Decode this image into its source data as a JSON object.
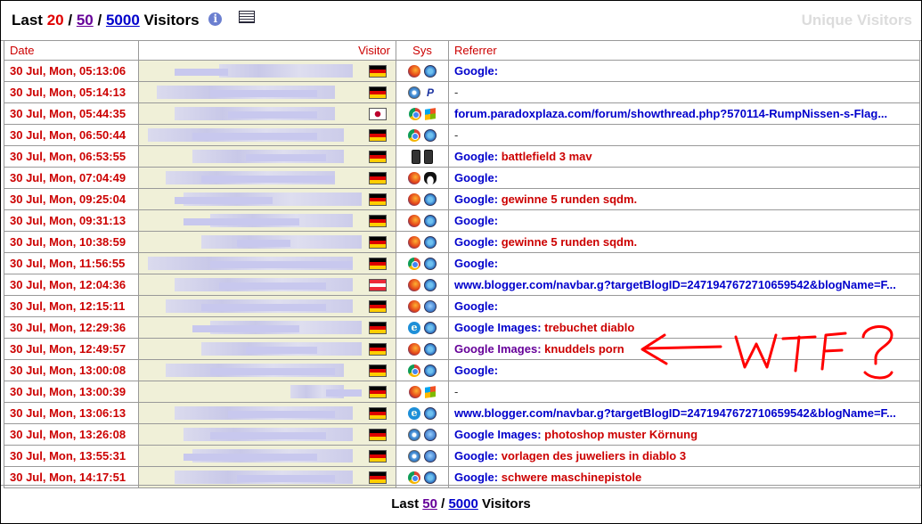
{
  "header": {
    "prefix": "Last",
    "n20": "20",
    "n50": "50",
    "n5000": "5000",
    "suffix": "Visitors",
    "sep": "/",
    "unique": "Unique Visitors"
  },
  "columns": [
    "Date",
    "Visitor",
    "Sys",
    "Referrer"
  ],
  "rows": [
    {
      "date": "30 Jul, Mon, 05:13:06",
      "flag": "de",
      "browser": "firefox",
      "os": "windows",
      "src": "Google:",
      "term": ""
    },
    {
      "date": "30 Jul, Mon, 05:14:13",
      "flag": "de",
      "browser": "safari",
      "os": "playstation",
      "src": "-",
      "term": ""
    },
    {
      "date": "30 Jul, Mon, 05:44:35",
      "flag": "jp",
      "browser": "chrome",
      "os": "windows-xp",
      "src": "forum.paradoxplaza.com/forum/showthread.php?570114-RumpNissen-s-Flag...",
      "term": ""
    },
    {
      "date": "30 Jul, Mon, 06:50:44",
      "flag": "de",
      "browser": "chrome",
      "os": "windows",
      "src": "-",
      "term": ""
    },
    {
      "date": "30 Jul, Mon, 06:53:55",
      "flag": "de",
      "browser": "phone",
      "os": "phone",
      "src": "Google:",
      "term": "battlefield 3 mav"
    },
    {
      "date": "30 Jul, Mon, 07:04:49",
      "flag": "de",
      "browser": "firefox",
      "os": "linux",
      "src": "Google:",
      "term": ""
    },
    {
      "date": "30 Jul, Mon, 09:25:04",
      "flag": "de",
      "browser": "firefox",
      "os": "windows",
      "src": "Google:",
      "term": "gewinne 5 runden sqdm."
    },
    {
      "date": "30 Jul, Mon, 09:31:13",
      "flag": "de",
      "browser": "firefox",
      "os": "windows",
      "src": "Google:",
      "term": ""
    },
    {
      "date": "30 Jul, Mon, 10:38:59",
      "flag": "de",
      "browser": "firefox",
      "os": "windows",
      "src": "Google:",
      "term": "gewinne 5 runden sqdm."
    },
    {
      "date": "30 Jul, Mon, 11:56:55",
      "flag": "de",
      "browser": "chrome",
      "os": "windows",
      "src": "Google:",
      "term": ""
    },
    {
      "date": "30 Jul, Mon, 12:04:36",
      "flag": "at",
      "browser": "firefox",
      "os": "windows",
      "src": "www.blogger.com/navbar.g?targetBlogID=2471947672710659542&blogName=F...",
      "term": ""
    },
    {
      "date": "30 Jul, Mon, 12:15:11",
      "flag": "de",
      "browser": "firefox",
      "os": "mac",
      "src": "Google:",
      "term": ""
    },
    {
      "date": "30 Jul, Mon, 12:29:36",
      "flag": "de",
      "browser": "ie",
      "os": "windows",
      "src": "Google Images:",
      "term": "trebuchet diablo"
    },
    {
      "date": "30 Jul, Mon, 12:49:57",
      "flag": "de",
      "browser": "firefox",
      "os": "windows",
      "src": "Google Images:",
      "term": "knuddels porn",
      "visited": true
    },
    {
      "date": "30 Jul, Mon, 13:00:08",
      "flag": "de",
      "browser": "chrome",
      "os": "windows",
      "src": "Google:",
      "term": ""
    },
    {
      "date": "30 Jul, Mon, 13:00:39",
      "flag": "de",
      "browser": "firefox",
      "os": "windows-xp",
      "src": "-",
      "term": ""
    },
    {
      "date": "30 Jul, Mon, 13:06:13",
      "flag": "de",
      "browser": "ie",
      "os": "windows",
      "src": "www.blogger.com/navbar.g?targetBlogID=2471947672710659542&blogName=F...",
      "term": ""
    },
    {
      "date": "30 Jul, Mon, 13:26:08",
      "flag": "de",
      "browser": "safari",
      "os": "mac",
      "src": "Google Images:",
      "term": "photoshop muster Körnung"
    },
    {
      "date": "30 Jul, Mon, 13:55:31",
      "flag": "de",
      "browser": "safari",
      "os": "mac",
      "src": "Google:",
      "term": "vorlagen des juweliers in diablo 3"
    },
    {
      "date": "30 Jul, Mon, 14:17:51",
      "flag": "de",
      "browser": "chrome",
      "os": "windows",
      "src": "Google:",
      "term": "schwere maschinepistole"
    }
  ],
  "footer": {
    "prefix": "Last",
    "n50": "50",
    "sep": "/",
    "n5000": "5000",
    "suffix": "Visitors"
  },
  "annotation": {
    "text": "WTF ?",
    "color": "#ff0000"
  }
}
